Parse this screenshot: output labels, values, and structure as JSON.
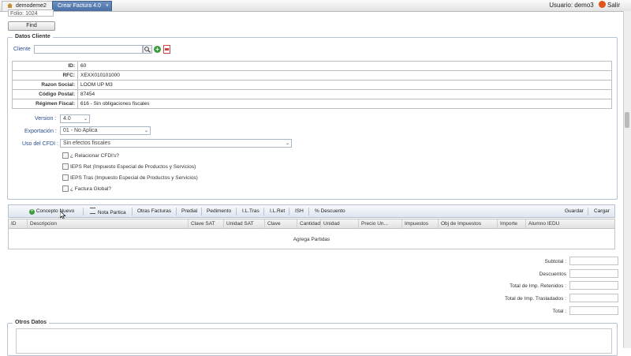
{
  "tabs": [
    {
      "label": "demodeme2"
    },
    {
      "label": "Crear Factura 4.0",
      "close": "×"
    }
  ],
  "user": {
    "label": "Usuario:",
    "name": "demo3",
    "exit": "Salir"
  },
  "folio": {
    "label": "Folio:",
    "value": "1024"
  },
  "buttons": {
    "find": "Find"
  },
  "client_section": {
    "legend": "Datos Cliente",
    "cliente_label": "Cliente",
    "cliente_value": "",
    "rows": [
      {
        "key": "ID:",
        "value": "60"
      },
      {
        "key": "RFC:",
        "value": "XEXX010101000"
      },
      {
        "key": "Razon Social:",
        "value": "LOOM UP M3"
      },
      {
        "key": "Código Postal:",
        "value": "87454"
      },
      {
        "key": "Régimen Fiscal:",
        "value": "616 - Sin obligaciones fiscales"
      }
    ],
    "version_label": "Version :",
    "version_value": "4.0",
    "exportacion_label": "Exportación :",
    "exportacion_value": "01 - No Aplica",
    "uso_label": "Uso del CFDI :",
    "uso_value": "Sin efectos fiscales",
    "checkboxes": [
      "¿ Relacionar CFDI's?",
      "IEPS Ret (Impuesto Especial de Productos y Servicios)",
      "IEPS Tras (Impuesto Especial de Productos y Servicios)",
      "¿ Factura Global?"
    ]
  },
  "toolbar": {
    "items": [
      "Concepto Nuevo",
      "Nota Partica",
      "Otras Facturas",
      "Predial",
      "Pedimento",
      "I.L.Tras",
      "I.L.Ret",
      "ISH",
      "% Descuento"
    ],
    "guardar": "Guardar",
    "cargar": "Cargar"
  },
  "grid": {
    "columns": [
      "ID",
      "Descripcion",
      "Clave SAT",
      "Unidad SAT",
      "Clave",
      "Cantidad",
      "Unidad",
      "Precio Un...",
      "Impuestos",
      "Obj de Impuestos",
      "Importe",
      "Alumno IEDU"
    ],
    "empty_text": "Agrega Partidas"
  },
  "totals": [
    {
      "label": "Subtotal :",
      "link": false
    },
    {
      "label": "Descuentos",
      "link": true
    },
    {
      "label": "Total de Imp. Retenidos :",
      "link": false
    },
    {
      "label": "Total de Imp. Trasladados :",
      "link": false
    },
    {
      "label": "Total :",
      "link": false
    }
  ],
  "otros_datos": {
    "legend": "Otros Datos"
  }
}
